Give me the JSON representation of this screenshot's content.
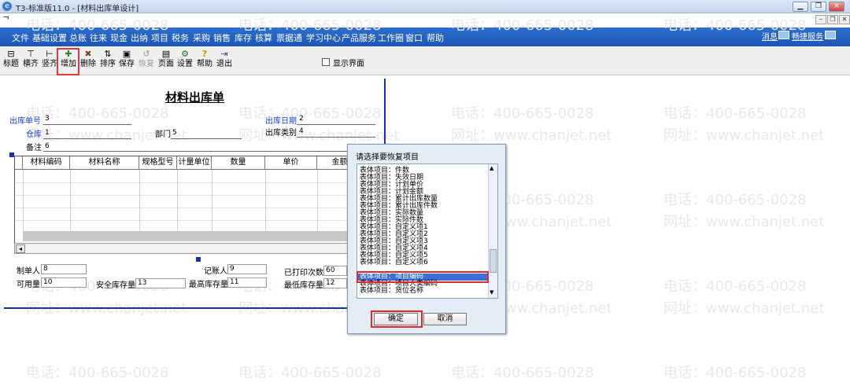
{
  "window": {
    "title": "T3-标准版11.0 - [材料出库单设计]",
    "sub_glyph": "ᄀ"
  },
  "menu": [
    "文件",
    "基础设置",
    "总账",
    "往来",
    "现金",
    "出纳",
    "项目",
    "税务",
    "采购",
    "销售",
    "库存",
    "核算",
    "票据通",
    "学习中心",
    "产品服务",
    "工作圈",
    "窗口",
    "帮助"
  ],
  "menu_right": {
    "messages": "消息",
    "service": "畅捷服务"
  },
  "toolbar": [
    {
      "label": "标题",
      "glyph": "⊟"
    },
    {
      "label": "横齐",
      "glyph": "⊤"
    },
    {
      "label": "竖齐",
      "glyph": "⊢"
    },
    {
      "label": "增加",
      "glyph": "✚"
    },
    {
      "label": "删除",
      "glyph": "✖"
    },
    {
      "label": "排序",
      "glyph": "⇅"
    },
    {
      "label": "保存",
      "glyph": "▣"
    },
    {
      "label": "恢复",
      "glyph": "↺"
    },
    {
      "label": "页面",
      "glyph": "▤"
    },
    {
      "label": "设置",
      "glyph": "⚙"
    },
    {
      "label": "帮助",
      "glyph": "?"
    },
    {
      "label": "退出",
      "glyph": "⇥"
    }
  ],
  "show_interface_label": "显示界面",
  "form": {
    "title": "材料出库单",
    "fields": {
      "doc_no": {
        "label": "出库单号",
        "value": "3"
      },
      "date": {
        "label": "出库日期",
        "value": "2"
      },
      "warehouse": {
        "label": "仓库",
        "value": "1"
      },
      "dept": {
        "label": "部门",
        "value": "5"
      },
      "type": {
        "label": "出库类别",
        "value": "4"
      },
      "note": {
        "label": "备注",
        "value": "6"
      },
      "maker": {
        "label": "制单人",
        "value": "8"
      },
      "bookkeeper": {
        "label": "记账人",
        "value": "9"
      },
      "printed": {
        "label": "已打印次数",
        "value": "60"
      },
      "available": {
        "label": "可用量",
        "value": "10"
      },
      "safety": {
        "label": "安全库存量",
        "value": "13"
      },
      "max": {
        "label": "最高库存量",
        "value": "11"
      },
      "min": {
        "label": "最低库存量",
        "value": "12"
      }
    },
    "columns": [
      "材料编码",
      "材料名称",
      "规格型号",
      "计量单位",
      "数量",
      "单价",
      "金额"
    ]
  },
  "watermark": {
    "phone": "电话：400-665-0028",
    "site": "网址：www.chanjet.net"
  },
  "dialog": {
    "title": "请选择要恢复项目",
    "items": [
      "表体项目：件数",
      "表体项目：失效日期",
      "表体项目：计划单价",
      "表体项目：计划金额",
      "表体项目：累计出库数量",
      "表体项目：累计出库件数",
      "表体项目：实际数量",
      "表体项目：实际件数",
      "表体项目：自定义项1",
      "表体项目：自定义项2",
      "表体项目：自定义项3",
      "表体项目：自定义项4",
      "表体项目：自定义项5",
      "表体项目：自定义项6",
      "表体项目：项目编码",
      "表体项目：项目大类编码",
      "表体项目：货位名称"
    ],
    "selected_index": 14,
    "ok": "确定",
    "cancel": "取消"
  }
}
